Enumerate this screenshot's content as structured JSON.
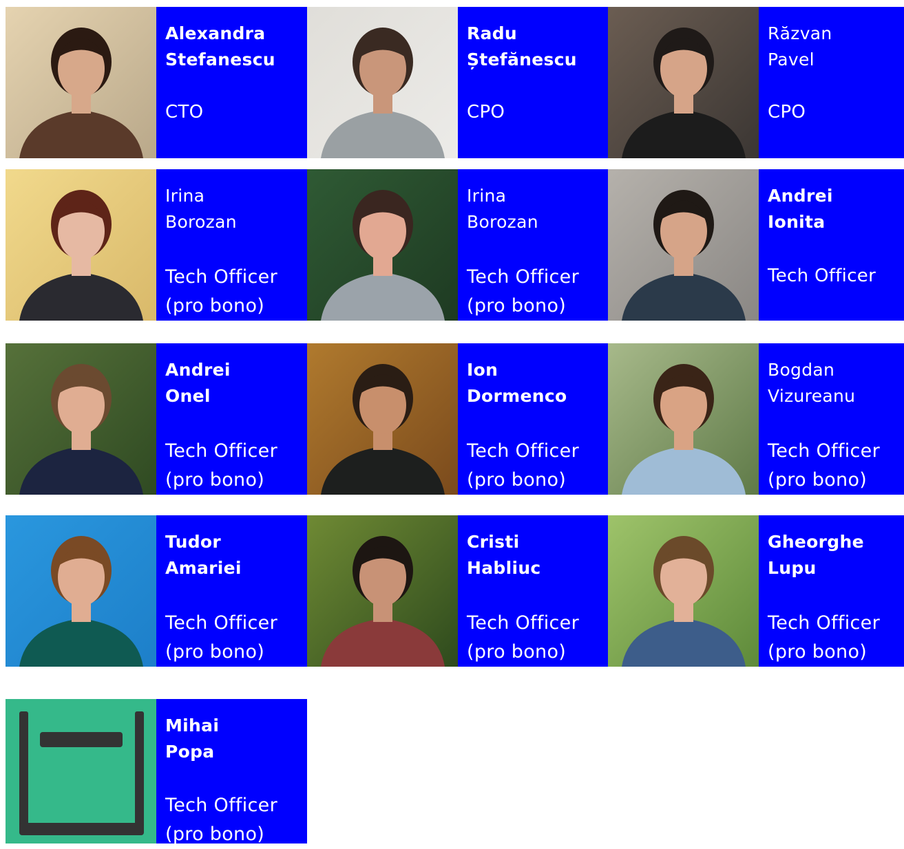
{
  "members": [
    {
      "first": "Alexandra",
      "last": "Stefanescu",
      "role1": "CTO",
      "role2": "",
      "bold": true,
      "photo": {
        "bg": "#b9a88a",
        "bg2": "#e5d3b0",
        "skin": "#d7a88a",
        "hair": "#2b1a12",
        "shirt": "#5a3a2a"
      }
    },
    {
      "first": "Radu",
      "last": "Ștefănescu",
      "role1": "CPO",
      "role2": "",
      "bold": true,
      "photo": {
        "bg": "#ecebe8",
        "bg2": "#e0ded9",
        "skin": "#c9967a",
        "hair": "#3a2a22",
        "shirt": "#9aa0a3"
      }
    },
    {
      "first": "Răzvan",
      "last": "Pavel",
      "role1": "CPO",
      "role2": "",
      "bold": false,
      "photo": {
        "bg": "#3b3633",
        "bg2": "#6b5d52",
        "skin": "#d6a488",
        "hair": "#1f1a18",
        "shirt": "#1c1c1c"
      }
    },
    {
      "first": "Irina",
      "last": "Borozan",
      "role1": "Tech Officer",
      "role2": "(pro bono)",
      "bold": false,
      "photo": {
        "bg": "#d9b96a",
        "bg2": "#f1d98c",
        "skin": "#e6b9a3",
        "hair": "#5e2418",
        "shirt": "#2a2a30"
      }
    },
    {
      "first": "Irina",
      "last": "Borozan",
      "role1": "Tech Officer",
      "role2": "(pro bono)",
      "bold": false,
      "photo": {
        "bg": "#1e3a22",
        "bg2": "#2f5a34",
        "skin": "#e2a892",
        "hair": "#3a2620",
        "shirt": "#9ba3aa"
      }
    },
    {
      "first": "Andrei",
      "last": "Ionita",
      "role1": "Tech Officer",
      "role2": "",
      "bold": true,
      "photo": {
        "bg": "#8a8784",
        "bg2": "#b5b1ab",
        "skin": "#d6a488",
        "hair": "#1f1915",
        "shirt": "#2b3a4a"
      }
    },
    {
      "first": "Andrei",
      "last": "Onel",
      "role1": "Tech Officer",
      "role2": "(pro bono)",
      "bold": true,
      "photo": {
        "bg": "#2f4a22",
        "bg2": "#56713a",
        "skin": "#e0ad92",
        "hair": "#6b4a30",
        "shirt": "#1c2440"
      }
    },
    {
      "first": "Ion",
      "last": "Dormenco",
      "role1": "Tech Officer",
      "role2": "(pro bono)",
      "bold": true,
      "photo": {
        "bg": "#7a4a1c",
        "bg2": "#b07a2e",
        "skin": "#c88f6c",
        "hair": "#2a1d14",
        "shirt": "#1d1f1e"
      }
    },
    {
      "first": "Bogdan",
      "last": "Vizureanu",
      "role1": "Tech Officer",
      "role2": "(pro bono)",
      "bold": false,
      "photo": {
        "bg": "#5f7a48",
        "bg2": "#a7b98a",
        "skin": "#d9a384",
        "hair": "#3a2417",
        "shirt": "#9fbcd6"
      }
    },
    {
      "first": "Tudor",
      "last": "Amariei",
      "role1": "Tech Officer",
      "role2": "(pro bono)",
      "bold": true,
      "photo": {
        "bg": "#1d7fc9",
        "bg2": "#2a97de",
        "skin": "#e0ad92",
        "hair": "#7a4a25",
        "shirt": "#0f5a52"
      }
    },
    {
      "first": "Cristi",
      "last": "Habliuc",
      "role1": "Tech Officer",
      "role2": "(pro bono)",
      "bold": true,
      "photo": {
        "bg": "#2e4a1d",
        "bg2": "#6f8a34",
        "skin": "#c89276",
        "hair": "#1d1612",
        "shirt": "#8a3a3a"
      }
    },
    {
      "first": "Gheorghe",
      "last": "Lupu",
      "role1": "Tech Officer",
      "role2": "(pro bono)",
      "bold": true,
      "photo": {
        "bg": "#5e8a3a",
        "bg2": "#9ec36a",
        "skin": "#e2b198",
        "hair": "#6b4a2a",
        "shirt": "#3d5d8a"
      }
    },
    {
      "first": "Mihai",
      "last": "Popa",
      "role1": "Tech Officer",
      "role2": "(pro bono)",
      "bold": true,
      "photo": {
        "bg": "#35b98a",
        "bg2": "#35b98a",
        "skin": "#333333",
        "hair": "#333333",
        "shirt": "#333333"
      }
    }
  ]
}
